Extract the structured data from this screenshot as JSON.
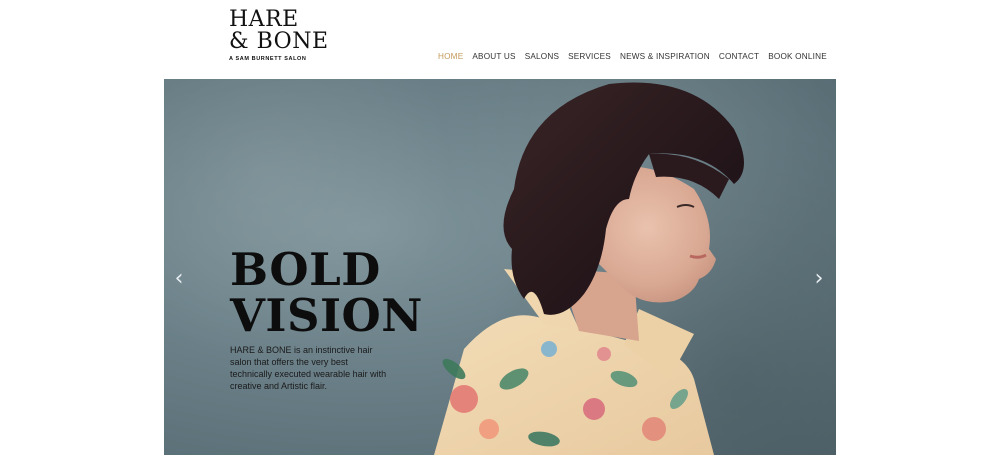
{
  "brand": {
    "line1": "HARE",
    "line2": "& BONE",
    "tagline": "A SAM BURNETT SALON"
  },
  "nav": [
    {
      "label": "HOME",
      "active": true
    },
    {
      "label": "ABOUT US",
      "active": false
    },
    {
      "label": "SALONS",
      "active": false
    },
    {
      "label": "SERVICES",
      "active": false
    },
    {
      "label": "NEWS & INSPIRATION",
      "active": false
    },
    {
      "label": "CONTACT",
      "active": false
    },
    {
      "label": "BOOK ONLINE",
      "active": false
    }
  ],
  "hero": {
    "headline_line1": "BOLD",
    "headline_line2": "VISION",
    "description": "HARE & BONE is an instinctive hair salon that offers the very best technically executed wearable hair with creative and Artistic flair.",
    "prev_icon": "chevron-left-icon",
    "next_icon": "chevron-right-icon"
  },
  "colors": {
    "accent": "#c49a5a",
    "hero_bg": "#6a7f87",
    "text": "#111111"
  }
}
